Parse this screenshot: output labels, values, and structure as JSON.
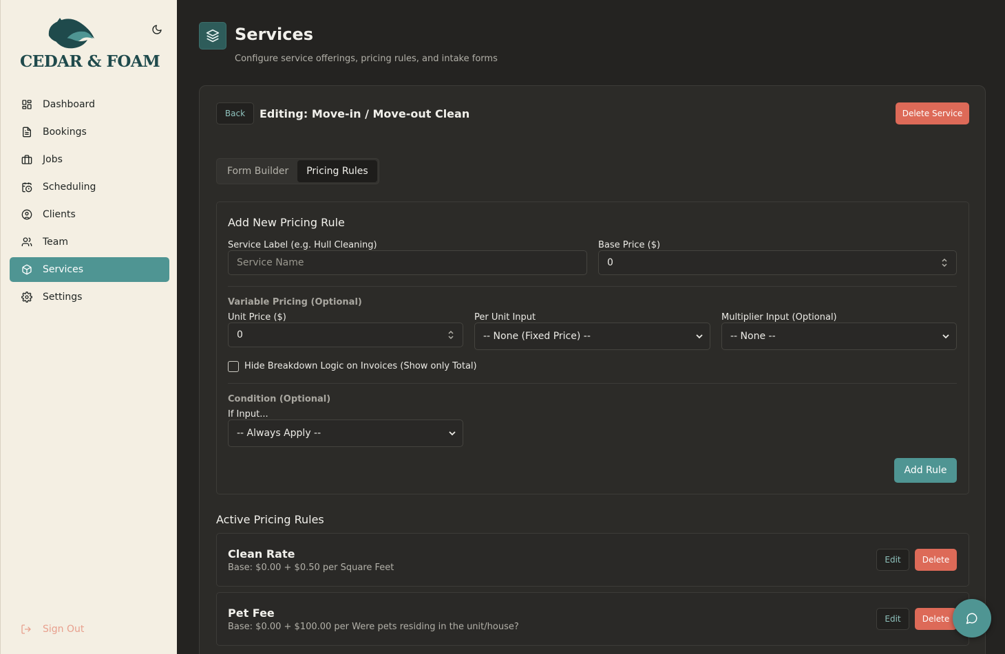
{
  "brand": {
    "name": "CEDAR & FOAM",
    "accent": "#4f9593",
    "danger": "#dd6a58"
  },
  "sidebar": {
    "items": [
      {
        "label": "Dashboard",
        "icon": "dashboard-icon"
      },
      {
        "label": "Bookings",
        "icon": "document-icon"
      },
      {
        "label": "Jobs",
        "icon": "briefcase-icon"
      },
      {
        "label": "Scheduling",
        "icon": "calendar-clock-icon"
      },
      {
        "label": "Clients",
        "icon": "user-circle-icon"
      },
      {
        "label": "Team",
        "icon": "users-icon"
      },
      {
        "label": "Services",
        "icon": "box-icon",
        "active": true
      },
      {
        "label": "Settings",
        "icon": "gear-icon"
      }
    ],
    "sign_out": "Sign Out"
  },
  "header": {
    "title": "Services",
    "subtitle": "Configure service offerings, pricing rules, and intake forms"
  },
  "editor": {
    "back_label": "Back",
    "title": "Editing: Move-in / Move-out Clean",
    "delete_service_label": "Delete Service",
    "tabs": [
      {
        "label": "Form Builder",
        "active": false
      },
      {
        "label": "Pricing Rules",
        "active": true
      }
    ]
  },
  "add_rule": {
    "title": "Add New Pricing Rule",
    "service_label_label": "Service Label (e.g. Hull Cleaning)",
    "service_label_placeholder": "Service Name",
    "base_price_label": "Base Price ($)",
    "base_price_value": "0",
    "variable_section": "Variable Pricing (Optional)",
    "unit_price_label": "Unit Price ($)",
    "unit_price_value": "0",
    "per_unit_label": "Per Unit Input",
    "per_unit_value": "-- None (Fixed Price) --",
    "multiplier_label": "Multiplier Input (Optional)",
    "multiplier_value": "-- None --",
    "hide_breakdown_label": "Hide Breakdown Logic on Invoices (Show only Total)",
    "hide_breakdown_checked": false,
    "condition_section": "Condition (Optional)",
    "if_input_label": "If Input...",
    "if_input_value": "-- Always Apply --",
    "submit_label": "Add Rule"
  },
  "active_rules": {
    "title": "Active Pricing Rules",
    "rules": [
      {
        "name": "Clean Rate",
        "description": "Base: $0.00 + $0.50 per Square Feet",
        "edit_label": "Edit",
        "delete_label": "Delete"
      },
      {
        "name": "Pet Fee",
        "description": "Base: $0.00 + $100.00 per Were pets residing in the unit/house?",
        "edit_label": "Edit",
        "delete_label": "Delete"
      }
    ]
  }
}
